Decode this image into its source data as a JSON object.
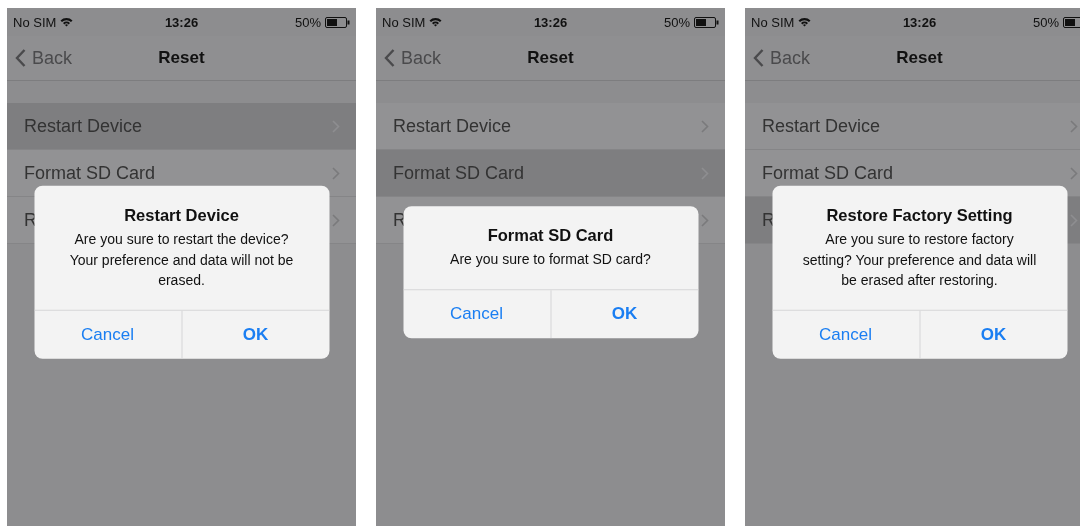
{
  "screens": [
    {
      "status_bar": {
        "carrier": "No SIM",
        "time": "13:26",
        "battery": "50%"
      },
      "nav_bar": {
        "back": "Back",
        "title": "Reset"
      },
      "rows": [
        {
          "label": "Restart Device",
          "selected": true
        },
        {
          "label": "Format SD Card",
          "selected": false
        },
        {
          "label": "R",
          "selected": false
        }
      ],
      "alert": {
        "title": "Restart Device",
        "message": "Are you sure to restart the device? Your preference and data will not be erased.",
        "buttons": [
          {
            "label": "Cancel",
            "bold": false
          },
          {
            "label": "OK",
            "bold": true
          }
        ]
      }
    },
    {
      "status_bar": {
        "carrier": "No SIM",
        "time": "13:26",
        "battery": "50%"
      },
      "nav_bar": {
        "back": "Back",
        "title": "Reset"
      },
      "rows": [
        {
          "label": "Restart Device",
          "selected": false
        },
        {
          "label": "Format SD Card",
          "selected": true
        },
        {
          "label": "R",
          "selected": false
        }
      ],
      "alert": {
        "title": "Format SD Card",
        "message": "Are you sure to format SD card?",
        "buttons": [
          {
            "label": "Cancel",
            "bold": false
          },
          {
            "label": "OK",
            "bold": true
          }
        ]
      }
    },
    {
      "status_bar": {
        "carrier": "No SIM",
        "time": "13:26",
        "battery": "50%"
      },
      "nav_bar": {
        "back": "Back",
        "title": "Reset"
      },
      "rows": [
        {
          "label": "Restart Device",
          "selected": false
        },
        {
          "label": "Format SD Card",
          "selected": false
        },
        {
          "label": "R",
          "selected": true
        }
      ],
      "alert": {
        "title": "Restore Factory Setting",
        "message": "Are you sure to restore factory setting? Your preference and data will be erased after restoring.",
        "buttons": [
          {
            "label": "Cancel",
            "bold": false
          },
          {
            "label": "OK",
            "bold": true
          }
        ]
      }
    }
  ]
}
